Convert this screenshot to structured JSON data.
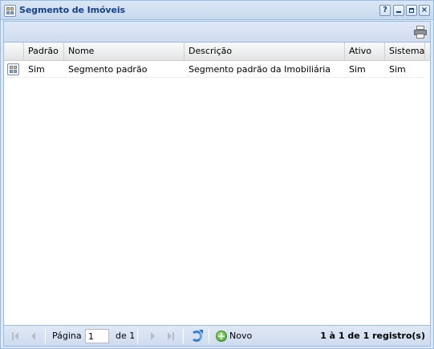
{
  "window": {
    "title": "Segmento de Imóveis",
    "title_icon": "grid-window-icon",
    "tools": {
      "help": "?",
      "minimize": "minimize-icon",
      "maximize": "maximize-icon",
      "close": "×"
    }
  },
  "toolbar": {
    "print_icon": "printer-icon"
  },
  "grid": {
    "columns": [
      "",
      "Padrão",
      "Nome",
      "Descrição",
      "Ativo",
      "Sistema"
    ],
    "rows": [
      {
        "icon": "record-icon",
        "padrao": "Sim",
        "nome": "Segmento padrão",
        "descricao": "Segmento padrão da Imobiliária",
        "ativo": "Sim",
        "sistema": "Sim"
      }
    ]
  },
  "pager": {
    "page_label": "Página",
    "page_value": "1",
    "of_label": "de 1",
    "new_label": "Novo",
    "info": "1 à 1 de 1 registro(s)"
  },
  "colors": {
    "title": "#15428b",
    "frame": "#99bbe8",
    "panel": "#dfe8f6"
  }
}
